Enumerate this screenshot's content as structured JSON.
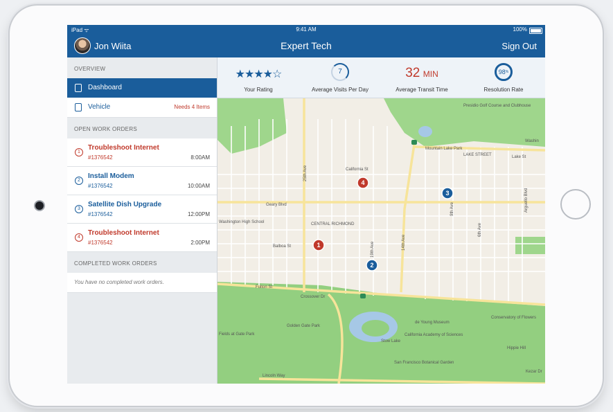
{
  "status_bar": {
    "carrier": "iPad ᯤ",
    "time": "9:41 AM",
    "battery": "100%"
  },
  "header": {
    "user_name": "Jon Wiita",
    "title": "Expert Tech",
    "sign_out": "Sign Out"
  },
  "sidebar": {
    "overview_heading": "OVERVIEW",
    "nav": [
      {
        "label": "Dashboard",
        "badge": ""
      },
      {
        "label": "Vehicle",
        "badge": "Needs 4 Items"
      }
    ],
    "open_heading": "OPEN WORK ORDERS",
    "open_orders": [
      {
        "num": "1",
        "title": "Troubleshoot Internet",
        "id": "#1376542",
        "time": "8:00AM",
        "status": "red"
      },
      {
        "num": "2",
        "title": "Install Modem",
        "id": "#1376542",
        "time": "10:00AM",
        "status": "blue"
      },
      {
        "num": "3",
        "title": "Satellite Dish Upgrade",
        "id": "#1376542",
        "time": "12:00PM",
        "status": "blue"
      },
      {
        "num": "4",
        "title": "Troubleshoot Internet",
        "id": "#1376542",
        "time": "2:00PM",
        "status": "red"
      }
    ],
    "completed_heading": "COMPLETED WORK ORDERS",
    "completed_empty": "You have no completed work orders."
  },
  "stats": {
    "rating": {
      "stars": "★★★★☆",
      "label": "Your Rating",
      "value": 4,
      "max": 5
    },
    "visits": {
      "value": "7",
      "label": "Average Visits Per Day"
    },
    "transit": {
      "value": "32",
      "unit": "MIN",
      "label": "Average Transit Time"
    },
    "resolution": {
      "value": "98",
      "label": "Resolution Rate"
    }
  },
  "map": {
    "labels": {
      "california_st": "California St",
      "geary_blvd": "Geary Blvd",
      "balboa_st": "Balboa St",
      "fulton_st": "Fulton St",
      "lake_street": "LAKE STREET",
      "lake_st": "Lake St",
      "central_richmond": "CENTRAL RICHMOND",
      "mountain_lake_park": "Mountain Lake Park",
      "golden_gate_park": "Golden Gate Park",
      "de_young": "de Young Museum",
      "academy": "California Academy of Sciences",
      "conservatory": "Conservatory of Flowers",
      "botanical": "San Francisco Botanical Garden",
      "lincoln_way": "Lincoln Way",
      "crossover": "Crossover Dr",
      "hippie_hill": "Hippie Hill",
      "stow_lake": "Stow Lake",
      "washington_hs": "Washington High School",
      "presidio_golf": "Presidio Golf Course and Clubhouse",
      "fields": "Fields at Gate Park",
      "ave_25": "25th Ave",
      "ave_19": "19th Ave",
      "ave_14": "14th Ave",
      "ave_9": "9th Ave",
      "ave_6": "6th Ave",
      "arguello": "Arguello Blvd",
      "washington": "Washin",
      "kezar": "Kezar Dr"
    },
    "pins": [
      {
        "num": "1",
        "status": "red"
      },
      {
        "num": "2",
        "status": "blue"
      },
      {
        "num": "3",
        "status": "blue"
      },
      {
        "num": "4",
        "status": "red"
      }
    ]
  },
  "colors": {
    "primary": "#1a5d9b",
    "alert": "#c0392b",
    "park": "#8fcf7d",
    "road": "#f7e49a"
  }
}
